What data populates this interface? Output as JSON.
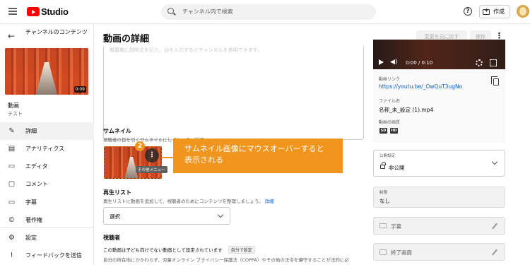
{
  "app": {
    "logo_text": "Studio"
  },
  "search": {
    "placeholder": "チャンネル内で検索"
  },
  "header": {
    "create_label": "作成",
    "help_glyph": "?"
  },
  "sidebar": {
    "channel_title": "チャンネルのコンテンツ",
    "thumb_duration": "0:09",
    "video_label": "動画",
    "video_title": "テスト",
    "items": [
      {
        "label": "詳細",
        "icon": "pencil-icon"
      },
      {
        "label": "アナリティクス",
        "icon": "analytics-icon"
      },
      {
        "label": "エディタ",
        "icon": "editor-icon"
      },
      {
        "label": "コメント",
        "icon": "comment-icon"
      },
      {
        "label": "字幕",
        "icon": "subtitles-icon"
      },
      {
        "label": "著作権",
        "icon": "copyright-icon"
      }
    ],
    "settings_label": "設定",
    "feedback_label": "フィードバックを送信"
  },
  "main": {
    "page_title": "動画の詳細",
    "undo_label": "変更を元に戻す",
    "save_label": "保存",
    "desc_faded_text": "概要欄に説明文を記入。@を入力するとチャンネルを参照できます。",
    "thumbnail": {
      "title": "サムネイル",
      "desc": "視聴者の目を引くサムネイルにしましょう。詳細",
      "menu_tooltip": "その他メニュー",
      "badge_number": "2",
      "callout_text_line1": "サムネイル画像にマウスオーバーすると",
      "callout_text_line2": "表示される"
    },
    "playlist": {
      "title": "再生リスト",
      "desc": "再生リストに動画を追加して、視聴者のためにコンテンツを整理しましょう。",
      "desc_link": "詳細",
      "select_value": "選択"
    },
    "audience": {
      "title": "視聴者",
      "line1": "この動画は子ども向けでない動画として設定されています",
      "badge": "自分で設定",
      "line2": "自分の所在地にかかわらず、児童オンライン プライバシー保護法（COPPA）やその他の法令を遵守することが法的に必"
    }
  },
  "right": {
    "player_time": "0:00 / 0:10",
    "link_label": "動画リンク",
    "link_value": "https://youtu.be/_OwQuT3ugNo",
    "file_label": "ファイル名",
    "file_value": "名称_未_設定 (1).mp4",
    "quality_label": "動画の画質",
    "quality_badges": [
      "SD",
      "HD"
    ],
    "visibility_label": "公開設定",
    "visibility_value": "非公開",
    "restriction_label": "制限",
    "restriction_value": "なし",
    "subtitles_label": "字幕",
    "endscreen_label": "終了画面"
  },
  "colors": {
    "accent_orange": "#f0961e",
    "youtube_red": "#ff0000",
    "link_blue": "#065fd4"
  }
}
